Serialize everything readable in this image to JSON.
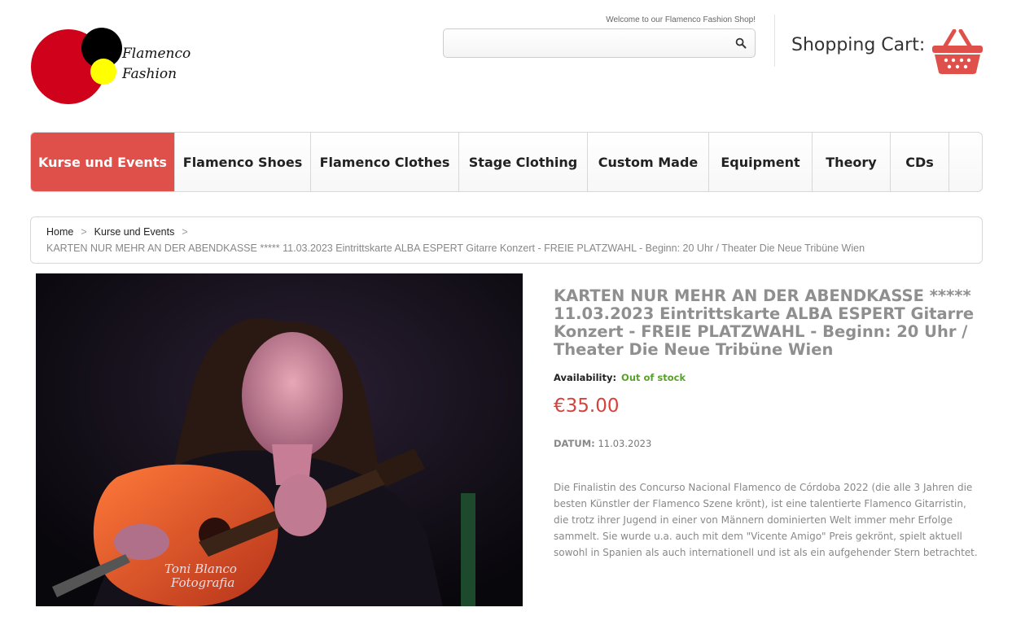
{
  "header": {
    "logo_line1": "Flamenco",
    "logo_line2": "Fashion",
    "welcome": "Welcome to our Flamenco Fashion Shop!",
    "search_value": "",
    "search_placeholder": "",
    "cart_label": "Shopping Cart:"
  },
  "nav": {
    "items": [
      {
        "label": "Kurse und Events",
        "active": true
      },
      {
        "label": "Flamenco Shoes",
        "active": false
      },
      {
        "label": "Flamenco Clothes",
        "active": false
      },
      {
        "label": "Stage Clothing",
        "active": false
      },
      {
        "label": "Custom Made",
        "active": false
      },
      {
        "label": "Equipment",
        "active": false
      },
      {
        "label": "Theory",
        "active": false
      },
      {
        "label": "CDs",
        "active": false
      }
    ]
  },
  "breadcrumb": {
    "home": "Home",
    "category": "Kurse und Events",
    "separator": ">",
    "current": "KARTEN NUR MEHR AN DER ABENDKASSE ***** 11.03.2023 Eintrittskarte ALBA ESPERT Gitarre Konzert - FREIE PLATZWAHL - Beginn: 20 Uhr / Theater Die Neue Tribüne Wien"
  },
  "product": {
    "image_caption_line1": "Toni Blanco",
    "image_caption_line2": "Fotografia",
    "title": "KARTEN NUR MEHR AN DER ABENDKASSE ***** 11.03.2023 Eintrittskarte ALBA ESPERT Gitarre Konzert - FREIE PLATZWAHL - Beginn: 20 Uhr / Theater Die Neue Tribüne Wien",
    "availability_label": "Availability:",
    "availability_value": "Out of stock",
    "price": "€35.00",
    "datum_label": "DATUM:",
    "datum_value": "11.03.2023",
    "description": "Die Finalistin des Concurso Nacional Flamenco de Córdoba 2022 (die alle 3 Jahren die besten Künstler der Flamenco Szene krönt), ist eine talentierte Flamenco Gitarristin, die trotz ihrer Jugend in einer von Männern dominierten Welt immer mehr Erfolge sammelt. Sie wurde u.a. auch mit dem \"Vicente Amigo\" Preis gekrönt, spielt aktuell sowohl in Spanien als auch internationell und ist als ein aufgehender Stern betrachtet."
  },
  "colors": {
    "accent": "#e0504a",
    "price": "#d9423c",
    "in_stock_green": "#5aa02c",
    "logo_red": "#d0021b",
    "logo_yellow": "#ffff00"
  },
  "icons": {
    "search": "search-icon",
    "cart": "basket-icon"
  }
}
